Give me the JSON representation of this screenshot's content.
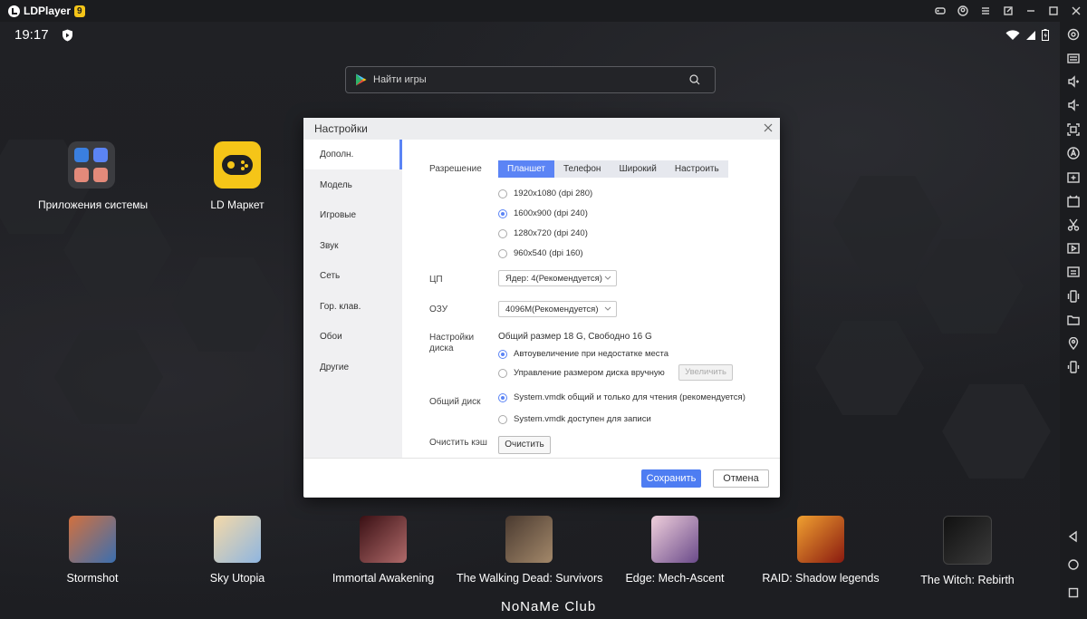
{
  "window": {
    "app_name": "LDPlayer",
    "version_badge": "9",
    "title_icons": [
      "gamepad-icon",
      "account-icon",
      "menu-icon",
      "popout-icon",
      "minimize-icon",
      "maximize-icon",
      "close-icon"
    ]
  },
  "status_bar": {
    "time": "19:17"
  },
  "search": {
    "placeholder": "Найти игры"
  },
  "desktop_apps": [
    {
      "label": "Приложения системы"
    },
    {
      "label": "LD Маркет"
    }
  ],
  "dock_apps": [
    {
      "label": "Stormshot",
      "color": "#c0623a"
    },
    {
      "label": "Sky Utopia",
      "color": "#8fb6e0"
    },
    {
      "label": "Immortal Awakening",
      "color": "#5a1d24"
    },
    {
      "label": "The Walking Dead: Survivors",
      "color": "#7a6552"
    },
    {
      "label": "Edge: Mech-Ascent",
      "color": "#c99ab5"
    },
    {
      "label": "RAID: Shadow legends",
      "color": "#c24a1a"
    },
    {
      "label": "The Witch: Rebirth",
      "color": "#222222"
    }
  ],
  "watermark": "NoNaMe Club",
  "dialog": {
    "title": "Настройки",
    "nav": [
      {
        "label": "Дополн."
      },
      {
        "label": "Модель"
      },
      {
        "label": "Игровые"
      },
      {
        "label": "Звук"
      },
      {
        "label": "Сеть"
      },
      {
        "label": "Гор. клав."
      },
      {
        "label": "Обои"
      },
      {
        "label": "Другие"
      }
    ],
    "resolution": {
      "label": "Разрешение",
      "tabs": [
        "Планшет",
        "Телефон",
        "Широкий",
        "Настроить"
      ],
      "active_tab": "Планшет",
      "options": [
        "1920x1080  (dpi 280)",
        "1600x900  (dpi 240)",
        "1280x720  (dpi 240)",
        "960x540  (dpi 160)"
      ],
      "selected": "1600x900  (dpi 240)"
    },
    "cpu": {
      "label": "ЦП",
      "value": "Ядер: 4(Рекомендуется)"
    },
    "ram": {
      "label": "ОЗУ",
      "value": "4096M(Рекомендуется)"
    },
    "disk": {
      "label_line1": "Настройки",
      "label_line2": "диска",
      "summary": "Общий размер 18 G,  Свободно 16 G",
      "opt_auto": "Автоувеличение при недостатке места",
      "opt_manual": "Управление размером диска вручную",
      "increase_button": "Увеличить"
    },
    "shared_disk": {
      "label": "Общий диск",
      "opt_readonly": "System.vmdk общий и только для чтения (рекомендуется)",
      "opt_writable": "System.vmdk доступен для записи"
    },
    "cache": {
      "label": "Очистить кэш",
      "button": "Очистить"
    },
    "save_button": "Сохранить",
    "cancel_button": "Отмена",
    "accent_color": "#4e7df2"
  }
}
